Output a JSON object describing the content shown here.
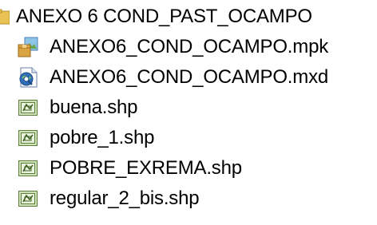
{
  "tree": {
    "folder": {
      "label": "ANEXO 6 COND_PAST_OCAMPO",
      "icon": "folder-icon"
    },
    "items": [
      {
        "label": "ANEXO6_COND_OCAMPO.mpk",
        "icon": "map-package-icon"
      },
      {
        "label": "ANEXO6_COND_OCAMPO.mxd",
        "icon": "map-document-icon"
      },
      {
        "label": "buena.shp",
        "icon": "shapefile-icon"
      },
      {
        "label": "pobre_1.shp",
        "icon": "shapefile-icon"
      },
      {
        "label": "POBRE_EXREMA.shp",
        "icon": "shapefile-icon"
      },
      {
        "label": "regular_2_bis.shp",
        "icon": "shapefile-icon"
      }
    ]
  }
}
